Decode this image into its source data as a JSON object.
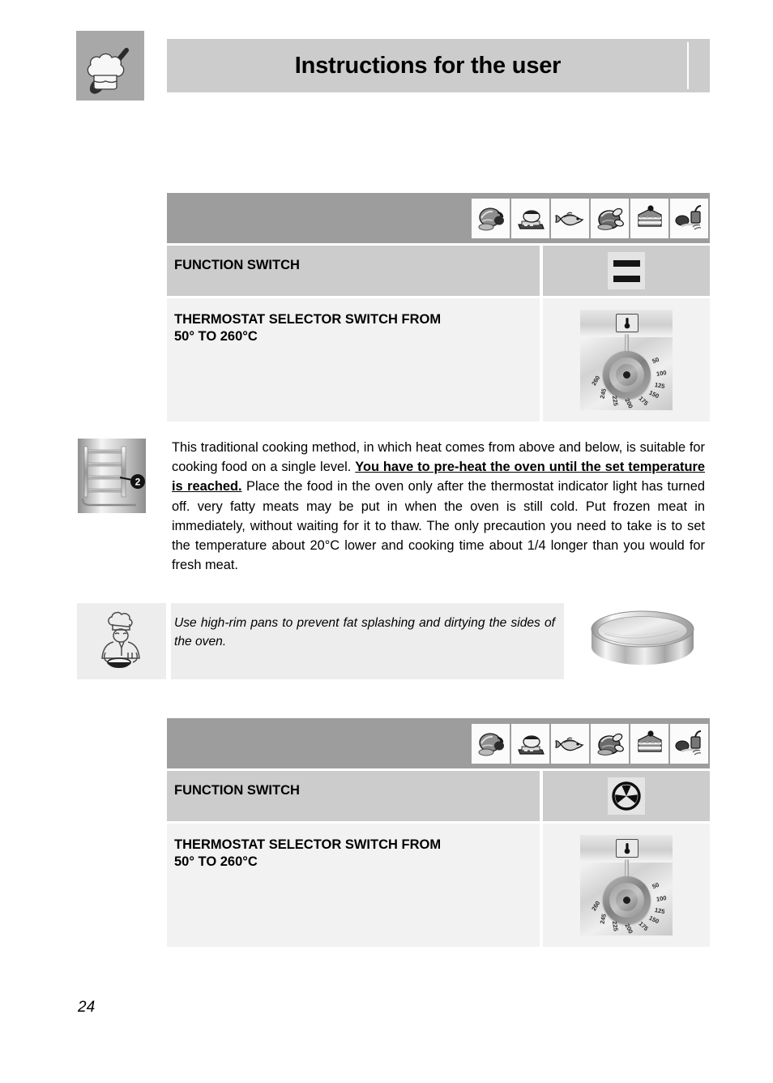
{
  "header": {
    "title": "Instructions for the user",
    "icon": "chef-hat-spoon-icon"
  },
  "food_icons": [
    {
      "name": "ham-roast-icon",
      "label": "Ham / roast meat"
    },
    {
      "name": "bread-loaf-icon",
      "label": "Bread / baking tray"
    },
    {
      "name": "fish-icon",
      "label": "Fish"
    },
    {
      "name": "roast-chicken-icon",
      "label": "Roast chicken"
    },
    {
      "name": "cake-slice-icon",
      "label": "Cake"
    },
    {
      "name": "vegetables-icon",
      "label": "Vegetables"
    }
  ],
  "tables": [
    {
      "id": "conventional-cooking",
      "function_row": {
        "label": "FUNCTION SWITCH",
        "symbol": "two-bars-icon",
        "symbol_meaning": "Top and bottom heating elements"
      },
      "thermostat_row": {
        "label": "THERMOSTAT SELECTOR SWITCH FROM\n50° TO 260°C",
        "label_line1": "THERMOSTAT SELECTOR SWITCH FROM",
        "label_line2": "50° TO 260°C",
        "knob": {
          "name": "thermostat-knob",
          "badge": "thermometer-icon",
          "ticks": [
            "50",
            "100",
            "125",
            "150",
            "175",
            "200",
            "225",
            "245",
            "260"
          ]
        }
      }
    },
    {
      "id": "fan-assisted-cooking",
      "function_row": {
        "label": "FUNCTION SWITCH",
        "symbol": "fan-icon",
        "symbol_meaning": "Fan assisted / circulaire"
      },
      "thermostat_row": {
        "label": "THERMOSTAT SELECTOR SWITCH FROM\n50° TO 260°C",
        "label_line1": "THERMOSTAT SELECTOR SWITCH FROM",
        "label_line2": "50° TO 260°C",
        "knob": {
          "name": "thermostat-knob",
          "badge": "thermometer-icon",
          "ticks": [
            "50",
            "100",
            "125",
            "150",
            "175",
            "200",
            "225",
            "245",
            "260"
          ]
        }
      }
    }
  ],
  "body": {
    "rack_image": "oven-shelf-rack-image",
    "rack_level_badge": "2",
    "text_part1": "This traditional cooking method, in which heat comes from above and below, is suitable for cooking food on a single level. ",
    "text_emphasis": "You have to pre-heat the oven until the set temperature is reached.",
    "text_part2": " Place the food in the oven only after the thermostat indicator light has turned off. very fatty meats may be put in when the oven is still cold. Put frozen meat in immediately, without waiting for it to thaw. The only precaution you need to take is to set the temperature about 20°C lower and cooking time about 1/4 longer than you would for fresh meat."
  },
  "tip": {
    "icon": "chef-figure-icon",
    "text": "Use high-rim pans to prevent fat splashing and dirtying the sides of the oven.",
    "side_image": "round-high-rim-pan-image"
  },
  "footer": {
    "page_number": "24"
  },
  "colors": {
    "table_header_band": "#9d9d9d",
    "function_row_bg": "#cccccc",
    "thermostat_row_bg": "#f2f2f2",
    "banner_bg": "#cccccc",
    "tip_bg": "#ededed",
    "page_bg": "#ffffff"
  }
}
